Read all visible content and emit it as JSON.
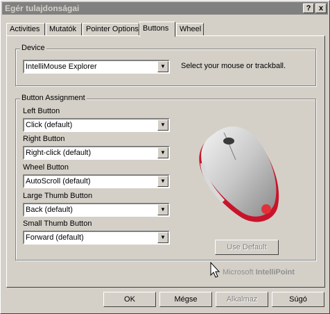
{
  "window": {
    "title": "Egér tulajdonságai",
    "help_glyph": "?",
    "close_glyph": "x"
  },
  "tabs": [
    {
      "label": "Activities"
    },
    {
      "label": "Mutatók"
    },
    {
      "label": "Pointer Options"
    },
    {
      "label": "Buttons",
      "active": true
    },
    {
      "label": "Wheel"
    }
  ],
  "device": {
    "group_label": "Device",
    "selected": "IntelliMouse Explorer",
    "hint": "Select your mouse or trackball."
  },
  "assignment": {
    "group_label": "Button Assignment",
    "rows": [
      {
        "label": "Left Button",
        "value": "Click (default)"
      },
      {
        "label": "Right Button",
        "value": "Right-click (default)"
      },
      {
        "label": "Wheel Button",
        "value": "AutoScroll (default)"
      },
      {
        "label": "Large Thumb Button",
        "value": "Back (default)"
      },
      {
        "label": "Small Thumb Button",
        "value": "Forward (default)"
      }
    ],
    "use_default_label": "Use Default"
  },
  "branding": {
    "prefix": "Microsoft",
    "product": "IntelliPoint"
  },
  "footer": {
    "ok": "OK",
    "cancel": "Mégse",
    "apply": "Alkalmaz",
    "help": "Súgó"
  },
  "colors": {
    "titlebar_inactive": "#808080",
    "mouse_accent": "#d81b28"
  }
}
